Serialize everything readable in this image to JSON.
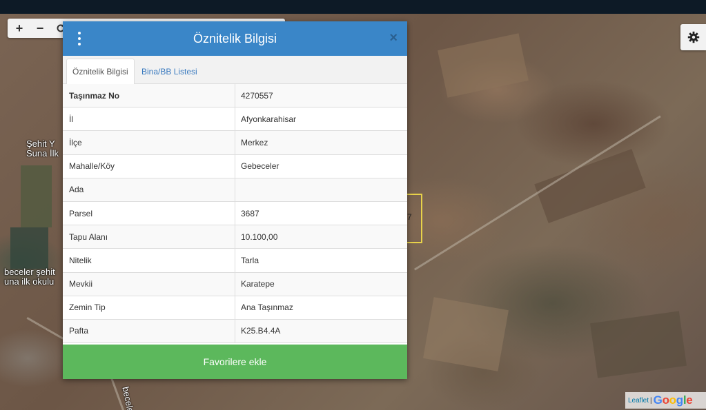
{
  "map": {
    "zoom_in": "+",
    "zoom_out": "−",
    "labels": [
      "Şehit Y\nSuna İlk",
      "beceler şehit\nuna ilk okulu",
      "beceler K"
    ],
    "parcel_label": "7",
    "attribution": {
      "leaflet": "Leaflet",
      "separator": "|",
      "google": [
        "G",
        "o",
        "o",
        "g",
        "l",
        "e"
      ]
    }
  },
  "modal": {
    "title": "Öznitelik Bilgisi",
    "close": "×",
    "tabs": [
      {
        "label": "Öznitelik Bilgisi",
        "active": true
      },
      {
        "label": "Bina/BB Listesi",
        "active": false
      }
    ],
    "rows": [
      {
        "key": "Taşınmaz No",
        "value": "4270557"
      },
      {
        "key": "İl",
        "value": "Afyonkarahisar"
      },
      {
        "key": "İlçe",
        "value": "Merkez"
      },
      {
        "key": "Mahalle/Köy",
        "value": "Gebeceler"
      },
      {
        "key": "Ada",
        "value": ""
      },
      {
        "key": "Parsel",
        "value": "3687"
      },
      {
        "key": "Tapu Alanı",
        "value": "10.100,00"
      },
      {
        "key": "Nitelik",
        "value": "Tarla"
      },
      {
        "key": "Mevkii",
        "value": "Karatepe"
      },
      {
        "key": "Zemin Tip",
        "value": "Ana Taşınmaz"
      },
      {
        "key": "Pafta",
        "value": "K25.B4.4A"
      }
    ],
    "favorite_button": "Favorilere ekle"
  },
  "colors": {
    "header_blue": "#3a86c8",
    "button_green": "#5cb85c",
    "link_blue": "#3a7abf"
  }
}
